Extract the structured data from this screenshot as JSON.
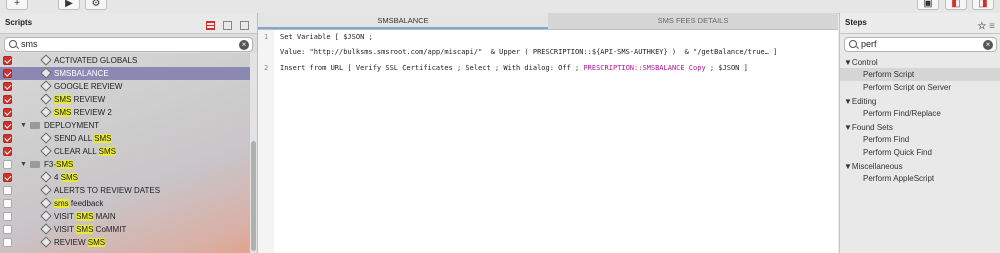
{
  "toolbar": {
    "left_buttons": [
      "+",
      "▶",
      "⚙"
    ],
    "right_buttons": [
      "▣",
      "◧",
      "◨"
    ]
  },
  "scripts_panel": {
    "title": "Scripts",
    "search": {
      "value": "sms"
    },
    "items": [
      {
        "pre": "ACTIVATED GLOBALS",
        "hl": "",
        "post": "",
        "checked": true,
        "type": "script",
        "indent": 2,
        "selected": false
      },
      {
        "pre": "SMSBALANCE",
        "hl": "",
        "post": "",
        "checked": true,
        "type": "script",
        "indent": 2,
        "selected": true
      },
      {
        "pre": "GOOGLE REVIEW",
        "hl": "",
        "post": "",
        "checked": true,
        "type": "script",
        "indent": 2,
        "selected": false
      },
      {
        "pre": "",
        "hl": "SMS",
        "post": " REVIEW",
        "checked": true,
        "type": "script",
        "indent": 2,
        "selected": false
      },
      {
        "pre": "",
        "hl": "SMS",
        "post": " REVIEW 2",
        "checked": true,
        "type": "script",
        "indent": 2,
        "selected": false
      },
      {
        "pre": "DEPLOYMENT",
        "hl": "",
        "post": "",
        "checked": true,
        "type": "folder",
        "indent": 1,
        "selected": false
      },
      {
        "pre": "SEND ALL ",
        "hl": "SMS",
        "post": "",
        "checked": true,
        "type": "script",
        "indent": 2,
        "selected": false
      },
      {
        "pre": "CLEAR ALL ",
        "hl": "SMS",
        "post": "",
        "checked": true,
        "type": "script",
        "indent": 2,
        "selected": false
      },
      {
        "pre": "F3-",
        "hl": "SMS",
        "post": "",
        "checked": false,
        "type": "folder",
        "indent": 1,
        "selected": false
      },
      {
        "pre": "4 ",
        "hl": "SMS",
        "post": "",
        "checked": true,
        "type": "script",
        "indent": 2,
        "selected": false
      },
      {
        "pre": "ALERTS TO REVIEW DATES",
        "hl": "",
        "post": "",
        "checked": false,
        "type": "script",
        "indent": 2,
        "selected": false
      },
      {
        "pre": "",
        "hl": "sms",
        "post": " feedback",
        "checked": false,
        "type": "script",
        "indent": 2,
        "selected": false
      },
      {
        "pre": "VISIT ",
        "hl": "SMS",
        "post": " MAIN",
        "checked": false,
        "type": "script",
        "indent": 2,
        "selected": false
      },
      {
        "pre": "VISIT ",
        "hl": "SMS",
        "post": " CoMMIT",
        "checked": false,
        "type": "script",
        "indent": 2,
        "selected": false
      },
      {
        "pre": "REVIEW ",
        "hl": "SMS",
        "post": "",
        "checked": false,
        "type": "script",
        "indent": 2,
        "selected": false
      }
    ]
  },
  "tabs": [
    "SMSBALANCE",
    "SMS FEES DETAILS"
  ],
  "editor": {
    "lines": [
      {
        "num": "1",
        "text": "Set Variable [ $JSON ;",
        "pink": "",
        "rest": ""
      },
      {
        "num": "",
        "text": "Value: \"http://bulksms.smsroot.com/app/miscapi/\"  & Upper ( PRESCRIPTION::${API-SMS-AUTHKEY} )  & \"/getBalance/true… ]",
        "pink": "",
        "rest": ""
      },
      {
        "num": "2",
        "text": "Insert from URL [ Verify SSL Certificates ; Select ; With dialog: Off ; ",
        "pink": "PRESCRIPTION::SMSBALANCE Copy",
        "rest": " ; $JSON ]"
      }
    ]
  },
  "steps_panel": {
    "title": "Steps",
    "search": {
      "value": "perf"
    },
    "groups": [
      {
        "name": "Control",
        "steps": [
          "Perform Script",
          "Perform Script on Server"
        ]
      },
      {
        "name": "Editing",
        "steps": [
          "Perform Find/Replace"
        ]
      },
      {
        "name": "Found Sets",
        "steps": [
          "Perform Find",
          "Perform Quick Find"
        ]
      },
      {
        "name": "Miscellaneous",
        "steps": [
          "Perform AppleScript"
        ]
      }
    ],
    "selected_step": "Perform Script"
  }
}
